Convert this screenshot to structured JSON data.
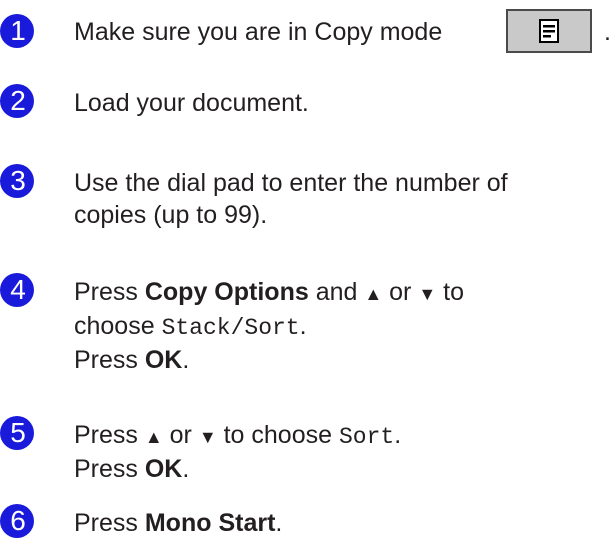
{
  "steps": [
    {
      "number": "1",
      "text": "Make sure you are in Copy mode",
      "tail": "."
    },
    {
      "number": "2",
      "text": "Load your document."
    },
    {
      "number": "3",
      "line1": "Use the dial pad to enter the number of",
      "line2": "copies (up to 99)."
    },
    {
      "number": "4",
      "press": "Press",
      "copy_options": "Copy Options",
      "and": "and",
      "up": "▲",
      "or": "or",
      "down": "▼",
      "to": "to",
      "choose": "choose",
      "option": "Stack/Sort",
      "period": ".",
      "press2": "Press",
      "ok": "OK",
      "period2": "."
    },
    {
      "number": "5",
      "press": "Press",
      "up": "▲",
      "or": "or",
      "down": "▼",
      "to_choose": "to choose",
      "option": "Sort",
      "period": ".",
      "press2": "Press",
      "ok": "OK",
      "period2": "."
    },
    {
      "number": "6",
      "press": "Press",
      "mono_start": "Mono Start",
      "period": "."
    }
  ],
  "copy_button_icon": "copy-mode-icon",
  "colors": {
    "badge": "#1a1adb",
    "button_bg": "#c9c9c9"
  }
}
